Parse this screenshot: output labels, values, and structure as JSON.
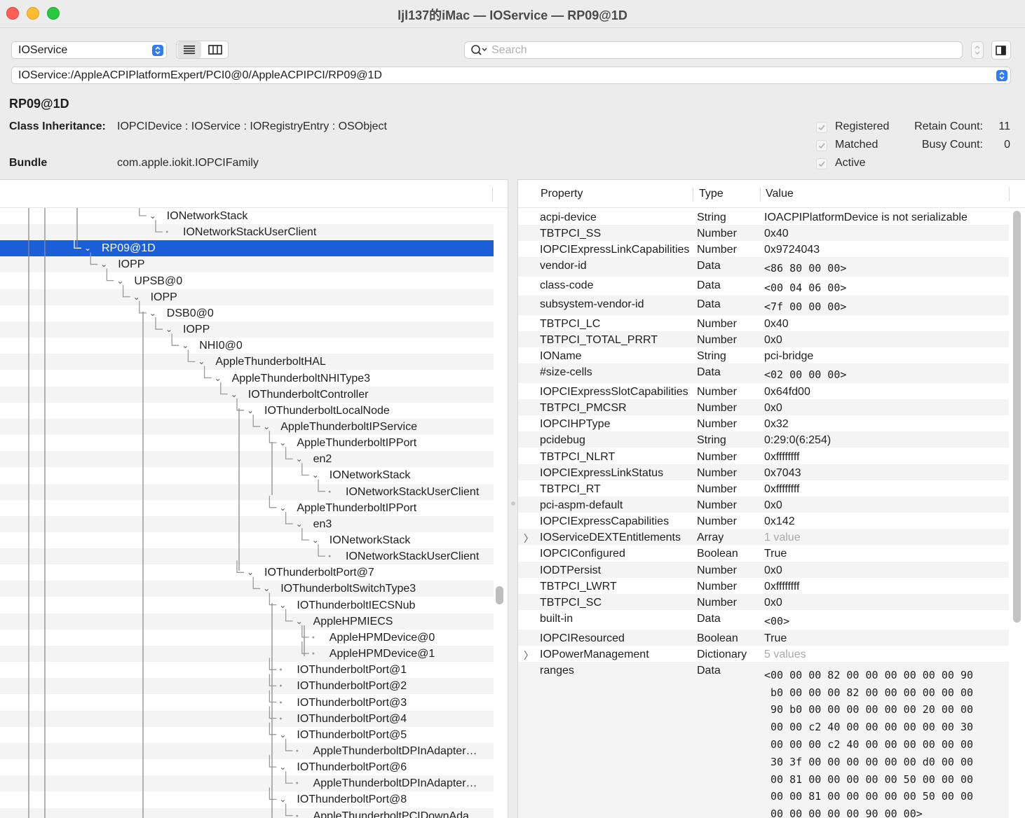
{
  "window": {
    "title": "ljl137的iMac — IOService — RP09@1D"
  },
  "toolbar": {
    "plane": "IOService",
    "search_placeholder": "Search",
    "path": "IOService:/AppleACPIPlatformExpert/PCI0@0/AppleACPIPCI/RP09@1D"
  },
  "info": {
    "name": "RP09@1D",
    "class_label": "Class Inheritance:",
    "class_value": "IOPCIDevice : IOService : IORegistryEntry : OSObject",
    "bundle_label": "Bundle",
    "bundle_value": "com.apple.iokit.IOPCIFamily",
    "flags": [
      "Registered",
      "Matched",
      "Active"
    ],
    "retain_label": "Retain Count:",
    "retain_value": "11",
    "busy_label": "Busy Count:",
    "busy_value": "0"
  },
  "tree": [
    {
      "label": "IONetworkStack",
      "depth": 8
    },
    {
      "label": "IONetworkStackUserClient",
      "depth": 9
    },
    {
      "label": "RP09@1D",
      "depth": 4
    },
    {
      "label": "IOPP",
      "depth": 5
    },
    {
      "label": "UPSB@0",
      "depth": 6
    },
    {
      "label": "IOPP",
      "depth": 7
    },
    {
      "label": "DSB0@0",
      "depth": 8
    },
    {
      "label": "IOPP",
      "depth": 9
    },
    {
      "label": "NHI0@0",
      "depth": 10
    },
    {
      "label": "AppleThunderboltHAL",
      "depth": 11
    },
    {
      "label": "AppleThunderboltNHIType3",
      "depth": 12
    },
    {
      "label": "IOThunderboltController",
      "depth": 13
    },
    {
      "label": "IOThunderboltLocalNode",
      "depth": 14
    },
    {
      "label": "AppleThunderboltIPService",
      "depth": 15
    },
    {
      "label": "AppleThunderboltIPPort",
      "depth": 16
    },
    {
      "label": "en2",
      "depth": 17
    },
    {
      "label": "IONetworkStack",
      "depth": 18
    },
    {
      "label": "IONetworkStackUserClient",
      "depth": 19
    },
    {
      "label": "AppleThunderboltIPPort",
      "depth": 16
    },
    {
      "label": "en3",
      "depth": 17
    },
    {
      "label": "IONetworkStack",
      "depth": 18
    },
    {
      "label": "IONetworkStackUserClient",
      "depth": 19
    },
    {
      "label": "IOThunderboltPort@7",
      "depth": 14
    },
    {
      "label": "IOThunderboltSwitchType3",
      "depth": 15
    },
    {
      "label": "IOThunderboltIECSNub",
      "depth": 16
    },
    {
      "label": "AppleHPMIECS",
      "depth": 17
    },
    {
      "label": "AppleHPMDevice@0",
      "depth": 18
    },
    {
      "label": "AppleHPMDevice@1",
      "depth": 18
    },
    {
      "label": "IOThunderboltPort@1",
      "depth": 16
    },
    {
      "label": "IOThunderboltPort@2",
      "depth": 16
    },
    {
      "label": "IOThunderboltPort@3",
      "depth": 16
    },
    {
      "label": "IOThunderboltPort@4",
      "depth": 16
    },
    {
      "label": "IOThunderboltPort@5",
      "depth": 16
    },
    {
      "label": "AppleThunderboltDPInAdapter…",
      "depth": 17
    },
    {
      "label": "IOThunderboltPort@6",
      "depth": 16
    },
    {
      "label": "AppleThunderboltDPInAdapter…",
      "depth": 17
    },
    {
      "label": "IOThunderboltPort@8",
      "depth": 16
    },
    {
      "label": "AppleThunderboltPCIDownAda…",
      "depth": 17
    }
  ],
  "properties": {
    "headers": [
      "Property",
      "Type",
      "Value"
    ],
    "rows": [
      {
        "p": "acpi-device",
        "t": "String",
        "v": "IOACPIPlatformDevice is not serializable"
      },
      {
        "p": "TBTPCI_SS",
        "t": "Number",
        "v": "0x40"
      },
      {
        "p": "IOPCIExpressLinkCapabilities",
        "t": "Number",
        "v": "0x9724043"
      },
      {
        "p": "vendor-id",
        "t": "Data",
        "v": "<86 80 00 00>",
        "mono": true
      },
      {
        "p": "class-code",
        "t": "Data",
        "v": "<00 04 06 00>",
        "mono": true
      },
      {
        "p": "subsystem-vendor-id",
        "t": "Data",
        "v": "<7f 00 00 00>",
        "mono": true
      },
      {
        "p": "TBTPCI_LC",
        "t": "Number",
        "v": "0x40"
      },
      {
        "p": "TBTPCI_TOTAL_PRRT",
        "t": "Number",
        "v": "0x0"
      },
      {
        "p": "IOName",
        "t": "String",
        "v": "pci-bridge"
      },
      {
        "p": "#size-cells",
        "t": "Data",
        "v": "<02 00 00 00>",
        "mono": true
      },
      {
        "p": "IOPCIExpressSlotCapabilities",
        "t": "Number",
        "v": "0x64fd00"
      },
      {
        "p": "TBTPCI_PMCSR",
        "t": "Number",
        "v": "0x0"
      },
      {
        "p": "IOPCIHPType",
        "t": "Number",
        "v": "0x32"
      },
      {
        "p": "pcidebug",
        "t": "String",
        "v": "0:29:0(6:254)"
      },
      {
        "p": "TBTPCI_NLRT",
        "t": "Number",
        "v": "0xffffffff"
      },
      {
        "p": "IOPCIExpressLinkStatus",
        "t": "Number",
        "v": "0x7043"
      },
      {
        "p": "TBTPCI_RT",
        "t": "Number",
        "v": "0xffffffff"
      },
      {
        "p": "pci-aspm-default",
        "t": "Number",
        "v": "0x0"
      },
      {
        "p": "IOPCIExpressCapabilities",
        "t": "Number",
        "v": "0x142"
      },
      {
        "p": "IOServiceDEXTEntitlements",
        "t": "Array",
        "v": "1 value",
        "muted": true,
        "expand": true
      },
      {
        "p": "IOPCIConfigured",
        "t": "Boolean",
        "v": "True"
      },
      {
        "p": "IODTPersist",
        "t": "Number",
        "v": "0x0"
      },
      {
        "p": "TBTPCI_LWRT",
        "t": "Number",
        "v": "0xffffffff"
      },
      {
        "p": "TBTPCI_SC",
        "t": "Number",
        "v": "0x0"
      },
      {
        "p": "built-in",
        "t": "Data",
        "v": "<00>",
        "mono": true
      },
      {
        "p": "IOPCIResourced",
        "t": "Boolean",
        "v": "True"
      },
      {
        "p": "IOPowerManagement",
        "t": "Dictionary",
        "v": "5 values",
        "muted": true,
        "expand": true
      },
      {
        "p": "ranges",
        "t": "Data",
        "v": "<00 00 00 82 00 00 00 00 00 00 90\n b0 00 00 00 82 00 00 00 00 00 00\n 90 b0 00 00 00 00 00 00 20 00 00\n 00 00 c2 40 00 00 00 00 00 00 30\n 00 00 00 c2 40 00 00 00 00 00 00\n 30 3f 00 00 00 00 00 00 d0 00 00\n 00 81 00 00 00 00 00 50 00 00 00\n 00 00 81 00 00 00 00 00 50 00 00\n 00 00 00 00 00 90 00 00>",
        "mono": true,
        "multiline": true
      }
    ]
  }
}
